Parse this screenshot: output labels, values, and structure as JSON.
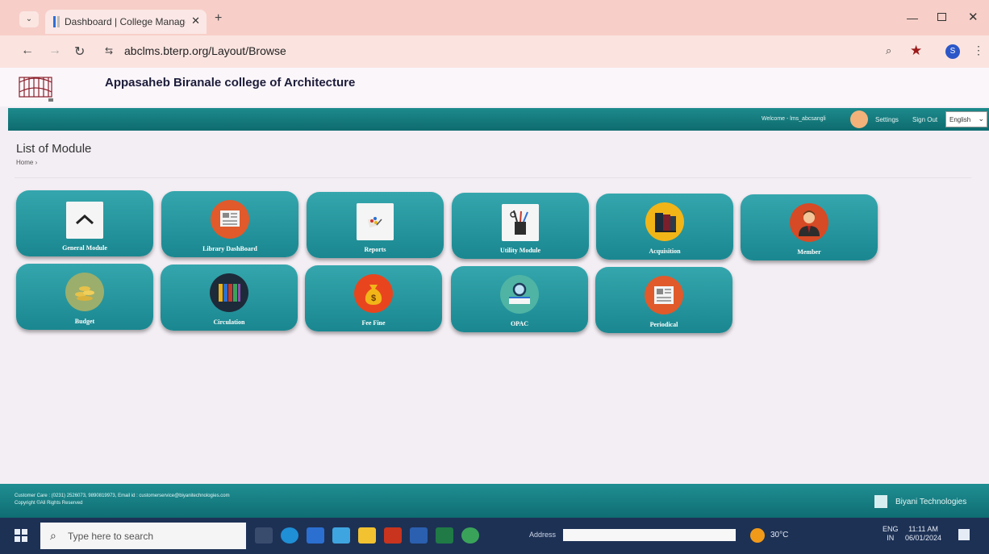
{
  "browser": {
    "tab_title": "Dashboard | College Managem",
    "tab_close": "✕",
    "new_tab": "+",
    "url": "abclms.bterp.org/Layout/Browse",
    "profile_initial": "S"
  },
  "app": {
    "college_name": "Appasaheb Biranale college of Architecture",
    "nav": {
      "welcome": "Welcome - lms_abcsangli",
      "settings": "Settings",
      "sign_out": "Sign Out",
      "language": "English"
    },
    "page_title": "List of Module",
    "breadcrumb": "Home ›"
  },
  "modules": [
    {
      "label": "General Module",
      "icon": "home-icon",
      "color": "#f5f5f5"
    },
    {
      "label": "Library DashBoard",
      "icon": "dashboard-icon",
      "color": "#e05a2b"
    },
    {
      "label": "Reports",
      "icon": "reports-icon",
      "color": "#f5f5f5"
    },
    {
      "label": "Utility Module",
      "icon": "utility-tools-icon",
      "color": "#f5f5f5"
    },
    {
      "label": "Acquisition",
      "icon": "books-icon",
      "color": "#f2b518"
    },
    {
      "label": "Member",
      "icon": "member-icon",
      "color": "#d64a25"
    },
    {
      "label": "Budget",
      "icon": "budget-coins-icon",
      "color": "#9cae6c"
    },
    {
      "label": "Circulation",
      "icon": "circulation-books-icon",
      "color": "#1d2a3a"
    },
    {
      "label": "Fee Fine",
      "icon": "money-bag-icon",
      "color": "#e8451e"
    },
    {
      "label": "OPAC",
      "icon": "opac-search-icon",
      "color": "#4fb4a4"
    },
    {
      "label": "Periodical",
      "icon": "periodical-icon",
      "color": "#e05a2b"
    }
  ],
  "footer": {
    "customer_care": "Customer Care : (0231) 2526073, 9890819973,  Email id : customerservice@biyanitechnologies.com",
    "copyright": "Copyright ©All Rights Reserved",
    "brand": "Biyani Technologies"
  },
  "taskbar": {
    "search_placeholder": "Type here to search",
    "address_label": "Address",
    "weather": "30°C",
    "language_top": "ENG",
    "language_bottom": "IN",
    "time": "11:11 AM",
    "date": "06/01/2024"
  }
}
